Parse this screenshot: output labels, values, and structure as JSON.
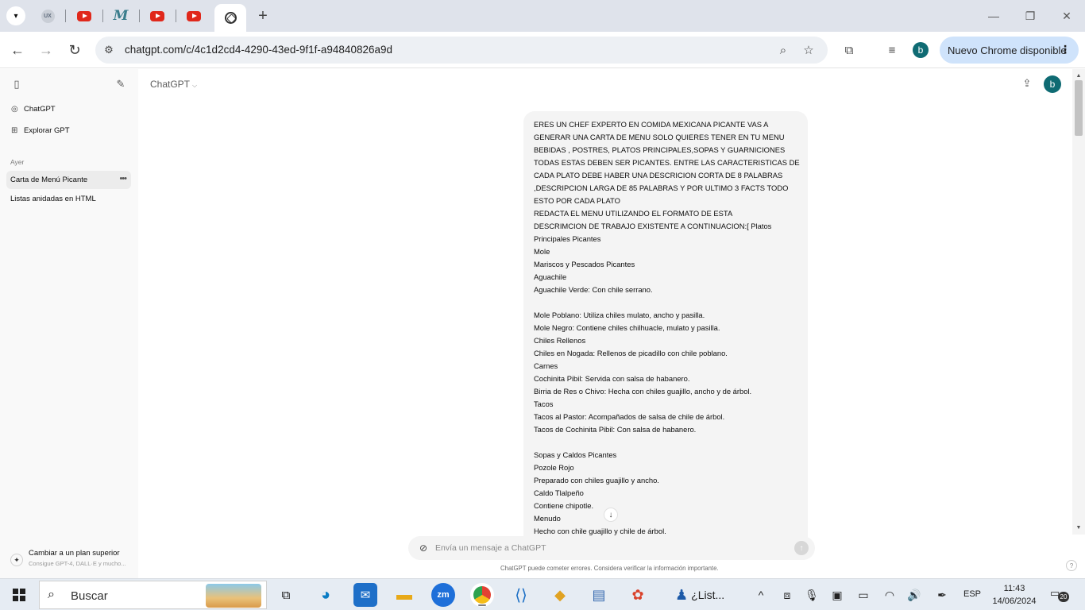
{
  "browser": {
    "url": "chatgpt.com/c/4c1d2cd4-4290-43ed-9f1f-a94840826a9d",
    "update_label": "Nuevo Chrome disponible",
    "profile_initial": "b",
    "window_controls": [
      "—",
      "❐",
      "✕"
    ]
  },
  "sidebar": {
    "nav": [
      {
        "label": "ChatGPT",
        "icon": "openai-logo-icon"
      },
      {
        "label": "Explorar GPT",
        "icon": "grid-icon"
      }
    ],
    "section_heading": "Ayer",
    "chats": [
      {
        "label": "Carta de Menú Picante",
        "active": true
      },
      {
        "label": "Listas anidadas en HTML",
        "active": false
      }
    ],
    "upgrade": {
      "title": "Cambiar a un plan superior",
      "subtitle": "Consigue GPT-4, DALL·E y mucho..."
    }
  },
  "header": {
    "model": "ChatGPT",
    "avatar_initial": "b"
  },
  "message": {
    "lines": [
      "ERES UN CHEF EXPERTO EN COMIDA MEXICANA PICANTE VAS A",
      "GENERAR UNA CARTA DE MENU SOLO QUIERES TENER EN TU MENU",
      "BEBIDAS , POSTRES, PLATOS PRINCIPALES,SOPAS Y GUARNICIONES",
      "TODAS ESTAS DEBEN SER PICANTES. ENTRE LAS CARACTERISTICAS DE",
      "CADA PLATO DEBE HABER UNA DESCRICION CORTA DE 8 PALABRAS",
      ",DESCRIPCION LARGA DE 85 PALABRAS Y POR ULTIMO 3 FACTS TODO",
      "ESTO POR CADA PLATO",
      "REDACTA EL MENU UTILIZANDO EL FORMATO DE ESTA",
      "DESCRIMCION DE TRABAJO EXISTENTE A CONTINUACION:[ Platos",
      "Principales Picantes",
      "Mole",
      "Mariscos y Pescados Picantes",
      "Aguachile",
      "Aguachile Verde: Con chile serrano.",
      "",
      "Mole Poblano: Utiliza chiles mulato, ancho y pasilla.",
      "Mole Negro: Contiene chiles chilhuacle, mulato y pasilla.",
      "Chiles Rellenos",
      "Chiles en Nogada: Rellenos de picadillo con chile poblano.",
      "Carnes",
      "Cochinita Pibil: Servida con salsa de habanero.",
      "Birria de Res o Chivo: Hecha con chiles guajillo, ancho y de árbol.",
      "Tacos",
      "Tacos al Pastor: Acompañados de salsa de chile de árbol.",
      "Tacos de Cochinita Pibil: Con salsa de habanero.",
      "",
      "Sopas y Caldos Picantes",
      "Pozole Rojo",
      "Preparado con chiles guajillo y ancho.",
      "Caldo Tlalpeño",
      "Contiene chipotle.",
      "Menudo",
      "Hecho con chile guajillo y chile de árbol."
    ]
  },
  "composer": {
    "placeholder": "Envía un mensaje a ChatGPT",
    "disclaimer": "ChatGPT puede cometer errores. Considera verificar la información importante.",
    "help": "?"
  },
  "taskbar": {
    "search_label": "Buscar",
    "window_label": "¿List...",
    "language": "ESP",
    "time": "11:43",
    "date": "14/06/2024",
    "notification_count": "20"
  }
}
